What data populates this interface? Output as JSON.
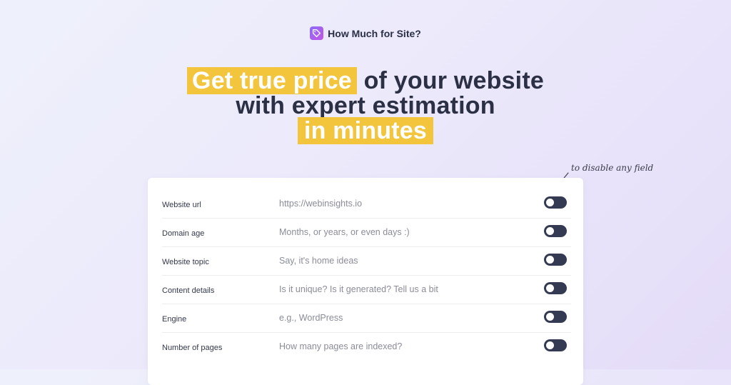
{
  "brand": {
    "name": "How Much for Site?",
    "icon": "tag-icon"
  },
  "hero": {
    "highlight1": "Get true price",
    "rest1": "of your website",
    "line2": "with expert estimation",
    "highlight2": "in minutes"
  },
  "hint": "to disable any field",
  "colors": {
    "highlight": "#f3c53d",
    "toggle": "#343a52",
    "brand_gradient": [
      "#8a6cf5",
      "#c456e6"
    ]
  },
  "fields": [
    {
      "label": "Website url",
      "placeholder": "https://webinsights.io",
      "enabled": false
    },
    {
      "label": "Domain age",
      "placeholder": "Months, or years, or even days :)",
      "enabled": false
    },
    {
      "label": "Website topic",
      "placeholder": "Say, it's home ideas",
      "enabled": false
    },
    {
      "label": "Content details",
      "placeholder": "Is it unique? Is it generated? Tell us a bit",
      "enabled": false
    },
    {
      "label": "Engine",
      "placeholder": "e.g., WordPress",
      "enabled": false
    },
    {
      "label": "Number of pages",
      "placeholder": "How many pages are indexed?",
      "enabled": false
    }
  ]
}
